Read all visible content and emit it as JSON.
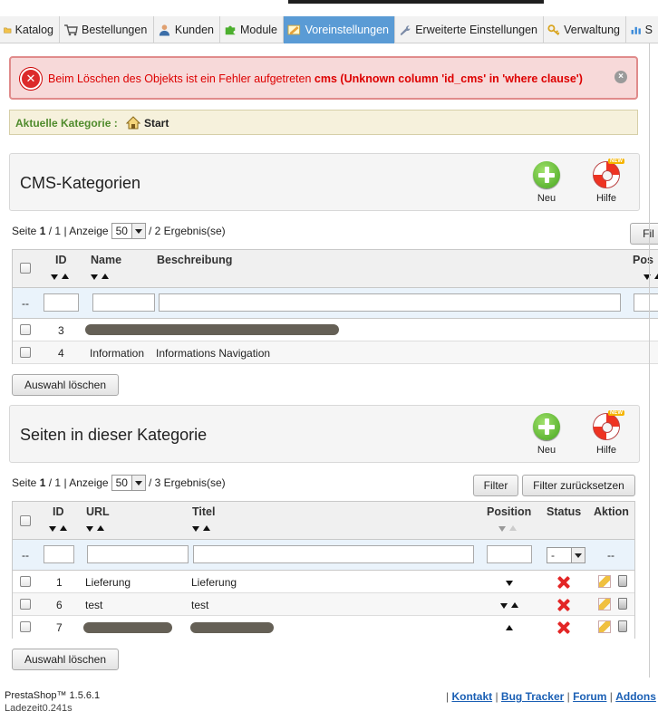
{
  "tabs": [
    {
      "label": "Katalog",
      "icon": "folder-icon",
      "active": false
    },
    {
      "label": "Bestellungen",
      "icon": "cart-icon",
      "active": false
    },
    {
      "label": "Kunden",
      "icon": "user-icon",
      "active": false
    },
    {
      "label": "Module",
      "icon": "puzzle-icon",
      "active": false
    },
    {
      "label": "Voreinstellungen",
      "icon": "preferences-icon",
      "active": true
    },
    {
      "label": "Erweiterte Einstellungen",
      "icon": "wrench-icon",
      "active": false
    },
    {
      "label": "Verwaltung",
      "icon": "key-icon",
      "active": false
    },
    {
      "label": "S",
      "icon": "stats-icon",
      "active": false
    }
  ],
  "error": {
    "text": "Beim Löschen des Objekts ist ein Fehler aufgetreten",
    "detail": "cms (Unknown column 'id_cms' in 'where clause')"
  },
  "breadcrumb": {
    "label": "Aktuelle Kategorie :",
    "item": "Start"
  },
  "categories": {
    "title": "CMS-Kategorien",
    "new_label": "Neu",
    "help_label": "Hilfe",
    "help_badge": "NEW",
    "pager": {
      "prefix": "Seite",
      "page": "1",
      "sep": "/",
      "pages": "1",
      "display": "| Anzeige",
      "per_page": "50",
      "results": "/ 2 Ergebnis(se)"
    },
    "filter_label": "Fil",
    "columns": {
      "id": "ID",
      "name": "Name",
      "desc": "Beschreibung",
      "pos": "Pos"
    },
    "filter_dash": "--",
    "rows": [
      {
        "id": "3",
        "name": "",
        "desc": ""
      },
      {
        "id": "4",
        "name": "Information",
        "desc": "Informations Navigation"
      }
    ],
    "delete_label": "Auswahl löschen"
  },
  "pages": {
    "title": "Seiten in dieser Kategorie",
    "new_label": "Neu",
    "help_label": "Hilfe",
    "help_badge": "NEW",
    "pager": {
      "prefix": "Seite",
      "page": "1",
      "sep": "/",
      "pages": "1",
      "display": "| Anzeige",
      "per_page": "50",
      "results": "/ 3 Ergebnis(se)"
    },
    "filter_label": "Filter",
    "reset_label": "Filter zurücksetzen",
    "columns": {
      "id": "ID",
      "url": "URL",
      "title": "Titel",
      "position": "Position",
      "status": "Status",
      "action": "Aktion"
    },
    "filter_dash": "--",
    "status_select": "-",
    "action_dash": "--",
    "rows": [
      {
        "id": "1",
        "url": "Lieferung",
        "title": "Lieferung"
      },
      {
        "id": "6",
        "url": "test",
        "title": "test"
      },
      {
        "id": "7",
        "url": "",
        "title": ""
      }
    ],
    "delete_label": "Auswahl löschen"
  },
  "footer": {
    "version": "PrestaShop™ 1.5.6.1",
    "load": "Ladezeit0.241s",
    "links": [
      "Kontakt",
      "Bug Tracker",
      "Forum",
      "Addons"
    ]
  },
  "colors": {
    "active_tab": "#5a9bd5",
    "error_text": "#dd0000",
    "breadcrumb_label": "#4f8b2c",
    "link": "#1a5fb4"
  }
}
